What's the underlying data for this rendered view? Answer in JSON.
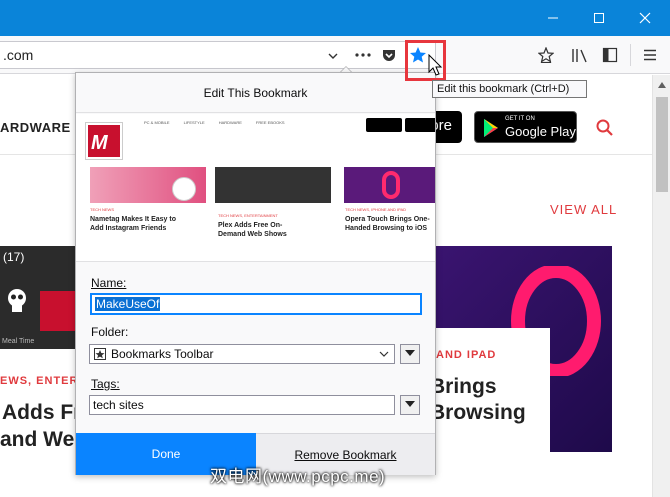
{
  "browser": {
    "url": ".com",
    "tooltip": "Edit this bookmark (Ctrl+D)",
    "accent": "#0a84ff"
  },
  "site": {
    "nav_hardware": "ARDWARE",
    "view_all": "VIEW ALL",
    "badge_count": "(17)",
    "category_left": "EWS, ENTER",
    "headline_left_1": "Adds Fr",
    "headline_left_2": "and We",
    "time_label": "Meal Time",
    "category_right": "AND IPAD",
    "headline_right_1": "Brings",
    "headline_right_2": "Browsing",
    "google_play_small": "GET IT ON",
    "google_play": "Google Play",
    "app_store": "ore"
  },
  "preview": {
    "nav_items": [
      "PC & MOBILE",
      "LIFESTYLE",
      "HARDWARE",
      "FREE EBOOKS"
    ],
    "cards": [
      {
        "tag": "TECH NEWS",
        "title": "Nametag Makes It Easy to Add Instagram Friends"
      },
      {
        "tag": "TECH NEWS, ENTERTAINMENT",
        "title": "Plex Adds Free On-Demand Web Shows"
      },
      {
        "tag": "TECH NEWS, IPHONE AND IPAD",
        "title": "Opera Touch Brings One-Handed Browsing to iOS"
      }
    ]
  },
  "bookmark_panel": {
    "title": "Edit This Bookmark",
    "name_label": "Name:",
    "name_value": "MakeUseOf",
    "folder_label": "Folder:",
    "folder_value": "Bookmarks Toolbar",
    "tags_label": "Tags:",
    "tags_value": "tech sites",
    "done_label": "Done",
    "remove_label": "Remove Bookmark"
  },
  "watermark": "双电网(www.pcpc.me)"
}
